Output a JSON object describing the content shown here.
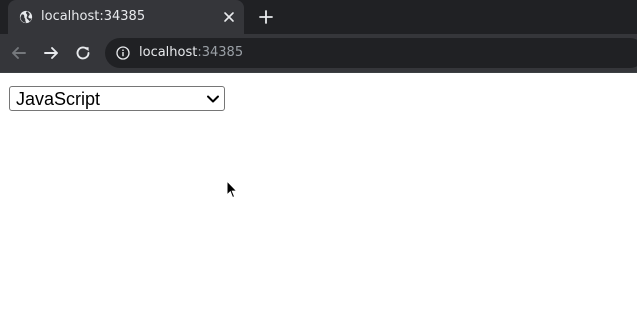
{
  "browser": {
    "tab": {
      "title": "localhost:34385",
      "favicon": "globe-icon"
    },
    "new_tab_icon": "plus-icon",
    "toolbar": {
      "back_icon": "arrow-left-icon",
      "forward_icon": "arrow-right-icon",
      "reload_icon": "reload-icon",
      "site_info_icon": "info-icon",
      "url_host": "localhost",
      "url_port": ":34385"
    }
  },
  "page": {
    "language_select": {
      "selected": "JavaScript"
    }
  },
  "colors": {
    "tabstrip_bg": "#202124",
    "toolbar_bg": "#35363a",
    "omnibox_bg": "#202124",
    "text_light": "#e8eaed",
    "text_dim": "#9aa0a6"
  }
}
